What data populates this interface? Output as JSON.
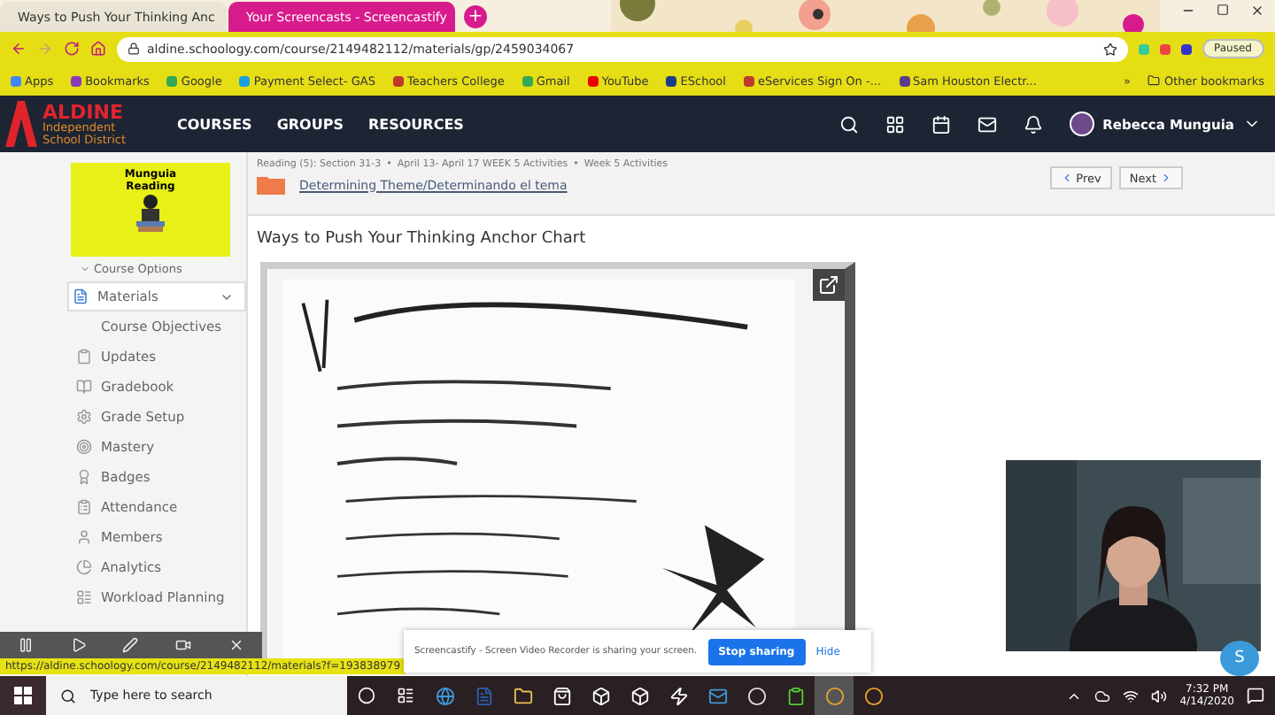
{
  "browser": {
    "tabs": [
      {
        "title": "Ways to Push Your Thinking Anc",
        "selected": false
      },
      {
        "title": "Your Screencasts - Screencastify",
        "selected": true
      }
    ],
    "new_tab": "+",
    "address": "aldine.schoology.com/course/2149482112/materials/gp/2459034067",
    "profile_status": "Paused",
    "bookmarks": [
      "Apps",
      "Bookmarks",
      "Google",
      "Payment Select- GAS",
      "Teachers College",
      "Gmail",
      "YouTube",
      "ESchool",
      "eServices Sign On -...",
      "Sam Houston Electr..."
    ],
    "overflow": "»",
    "other_bookmarks": "Other bookmarks"
  },
  "site_nav": {
    "logo": {
      "name": "ALDINE",
      "line_2": "Independent",
      "line_3": "School District"
    },
    "menu": [
      "COURSES",
      "GROUPS",
      "RESOURCES"
    ],
    "user": "Rebecca Munguia"
  },
  "sidebar": {
    "course_image_text": "Munguia Reading",
    "options": "Course Options",
    "items": [
      {
        "label": "Materials",
        "selected": true,
        "expanded": true,
        "children": [
          {
            "label": "Course Objectives",
            "selected": false
          }
        ]
      },
      {
        "label": "Updates",
        "selected": false
      },
      {
        "label": "Gradebook",
        "selected": false
      },
      {
        "label": "Grade Setup",
        "selected": false
      },
      {
        "label": "Mastery",
        "selected": false
      },
      {
        "label": "Badges",
        "selected": false
      },
      {
        "label": "Attendance",
        "selected": false
      },
      {
        "label": "Members",
        "selected": false
      },
      {
        "label": "Analytics",
        "selected": false
      },
      {
        "label": "Workload Planning",
        "selected": false
      }
    ]
  },
  "content": {
    "breadcrumb_separator": "•",
    "breadcrumb": [
      "Reading (5): Section 31-3",
      "April 13- April 17 WEEK 5 Activities",
      "Week 5 Activities"
    ],
    "folder": "Determining Theme/Determinando el tema",
    "prev": "Prev",
    "next": "Next",
    "title": "Ways to Push Your Thinking Anchor Chart"
  },
  "status_url": "https://aldine.schoology.com/course/2149482112/materials?f=193838979",
  "sharing_bar": {
    "message": "Screencastify - Screen Video Recorder is sharing your screen.",
    "stop": "Stop sharing",
    "hide": "Hide"
  },
  "chat_bubble": "S",
  "taskbar": {
    "search_placeholder": "Type here to search",
    "time": "7:32 PM",
    "date": "4/14/2020"
  }
}
